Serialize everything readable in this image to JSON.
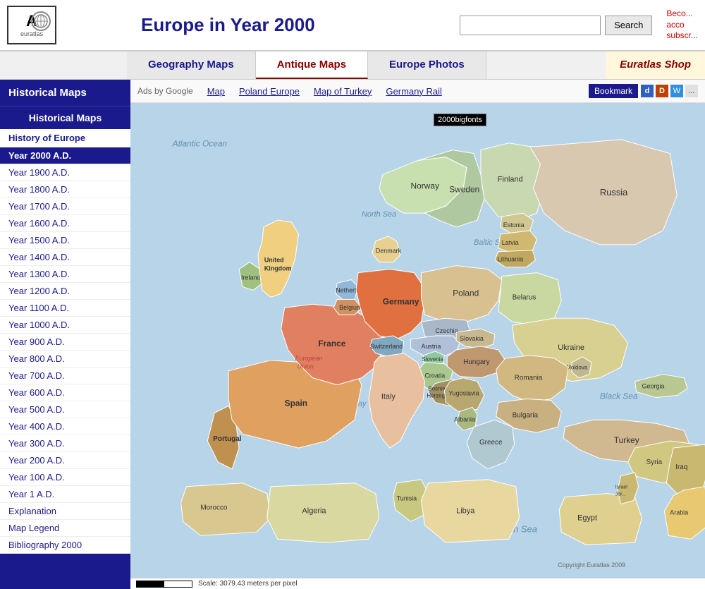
{
  "header": {
    "title": "Europe in Year 2000",
    "logo_letter": "A",
    "logo_name": "euratlas",
    "search_placeholder": "",
    "search_button_label": "Search",
    "header_right_text": "Beco...\nacc\nsubscr..."
  },
  "nav": {
    "tabs": [
      {
        "label": "Geography Maps",
        "id": "geo",
        "active": false
      },
      {
        "label": "Antique Maps",
        "id": "antique",
        "active": true
      },
      {
        "label": "Europe Photos",
        "id": "photos",
        "active": false
      }
    ],
    "shop_label": "Euratlas Shop"
  },
  "sidebar": {
    "header_label": "Historical Maps",
    "sub_header_label": "Historical Maps",
    "history_of_europe_label": "History of Europe",
    "items": [
      {
        "label": "Year 2000 A.D.",
        "active": true
      },
      {
        "label": "Year 1900 A.D.",
        "active": false
      },
      {
        "label": "Year 1800 A.D.",
        "active": false
      },
      {
        "label": "Year 1700 A.D.",
        "active": false
      },
      {
        "label": "Year 1600 A.D.",
        "active": false
      },
      {
        "label": "Year 1500 A.D.",
        "active": false
      },
      {
        "label": "Year 1400 A.D.",
        "active": false
      },
      {
        "label": "Year 1300 A.D.",
        "active": false
      },
      {
        "label": "Year 1200 A.D.",
        "active": false
      },
      {
        "label": "Year 1100 A.D.",
        "active": false
      },
      {
        "label": "Year 1000 A.D.",
        "active": false
      },
      {
        "label": "Year 900 A.D.",
        "active": false
      },
      {
        "label": "Year 800 A.D.",
        "active": false
      },
      {
        "label": "Year 700 A.D.",
        "active": false
      },
      {
        "label": "Year 600 A.D.",
        "active": false
      },
      {
        "label": "Year 500 A.D.",
        "active": false
      },
      {
        "label": "Year 400 A.D.",
        "active": false
      },
      {
        "label": "Year 300 A.D.",
        "active": false
      },
      {
        "label": "Year 200 A.D.",
        "active": false
      },
      {
        "label": "Year 100 A.D.",
        "active": false
      },
      {
        "label": "Year 1 A.D.",
        "active": false
      },
      {
        "label": "Explanation",
        "active": false
      },
      {
        "label": "Map Legend",
        "active": false
      },
      {
        "label": "Bibliography 2000",
        "active": false
      }
    ]
  },
  "ad_bar": {
    "ads_label": "Ads by Google",
    "links": [
      "Map",
      "Poland Europe",
      "Map of Turkey",
      "Germany Rail"
    ],
    "bookmark_label": "Bookmark"
  },
  "map": {
    "badge_text": "2000bigfonts",
    "copyright": "Copyright Euratlas 2009",
    "scale_text": "Scale: 3079.43 meters per pixel",
    "countries": [
      {
        "name": "United Kingdom",
        "color": "#f0d080"
      },
      {
        "name": "Ireland",
        "color": "#a0c080"
      },
      {
        "name": "Norway",
        "color": "#c8e0b0"
      },
      {
        "name": "Sweden",
        "color": "#b0c8a0"
      },
      {
        "name": "Finland",
        "color": "#c8d8b0"
      },
      {
        "name": "Estonia",
        "color": "#d0c890"
      },
      {
        "name": "Latvia",
        "color": "#d0b870"
      },
      {
        "name": "Lithuania",
        "color": "#c0a860"
      },
      {
        "name": "Denmark",
        "color": "#e8d090"
      },
      {
        "name": "Netherlands",
        "color": "#90b8d8"
      },
      {
        "name": "Belgium",
        "color": "#d09060"
      },
      {
        "name": "Germany",
        "color": "#e07040"
      },
      {
        "name": "Poland",
        "color": "#d8c090"
      },
      {
        "name": "Belarus",
        "color": "#c8d8a0"
      },
      {
        "name": "Russia",
        "color": "#d8c8b0"
      },
      {
        "name": "France",
        "color": "#e08060"
      },
      {
        "name": "European Union",
        "color": "#c04040"
      },
      {
        "name": "Switzerland",
        "color": "#80a8c0"
      },
      {
        "name": "Austria",
        "color": "#b0c0d8"
      },
      {
        "name": "Czechia",
        "color": "#a8b8c8"
      },
      {
        "name": "Slovakia",
        "color": "#c8b890"
      },
      {
        "name": "Hungary",
        "color": "#c09870"
      },
      {
        "name": "Slovenia",
        "color": "#90c8a0"
      },
      {
        "name": "Croatia",
        "color": "#a8c890"
      },
      {
        "name": "Ukraine",
        "color": "#d8d090"
      },
      {
        "name": "Moldova",
        "color": "#c0b890"
      },
      {
        "name": "Romania",
        "color": "#d0b880"
      },
      {
        "name": "Yugoslavia",
        "color": "#b8a870"
      },
      {
        "name": "Bosnia-Herzegovina",
        "color": "#a09060"
      },
      {
        "name": "Bulgaria",
        "color": "#c8b080"
      },
      {
        "name": "Albania",
        "color": "#a8b880"
      },
      {
        "name": "Greece",
        "color": "#b0c8d0"
      },
      {
        "name": "Turkey",
        "color": "#d0b890"
      },
      {
        "name": "Spain",
        "color": "#e0a060"
      },
      {
        "name": "Portugal",
        "color": "#c09050"
      },
      {
        "name": "Morocco",
        "color": "#d8c890"
      },
      {
        "name": "Algeria",
        "color": "#d8d8a0"
      },
      {
        "name": "Tunisia",
        "color": "#c8c880"
      },
      {
        "name": "Libya",
        "color": "#e8d8a0"
      },
      {
        "name": "Egypt",
        "color": "#e0d090"
      },
      {
        "name": "Syria",
        "color": "#d0c880"
      },
      {
        "name": "Iraq",
        "color": "#c8b870"
      },
      {
        "name": "Georgia",
        "color": "#b8c890"
      },
      {
        "name": "Arabia",
        "color": "#e8c870"
      }
    ]
  }
}
